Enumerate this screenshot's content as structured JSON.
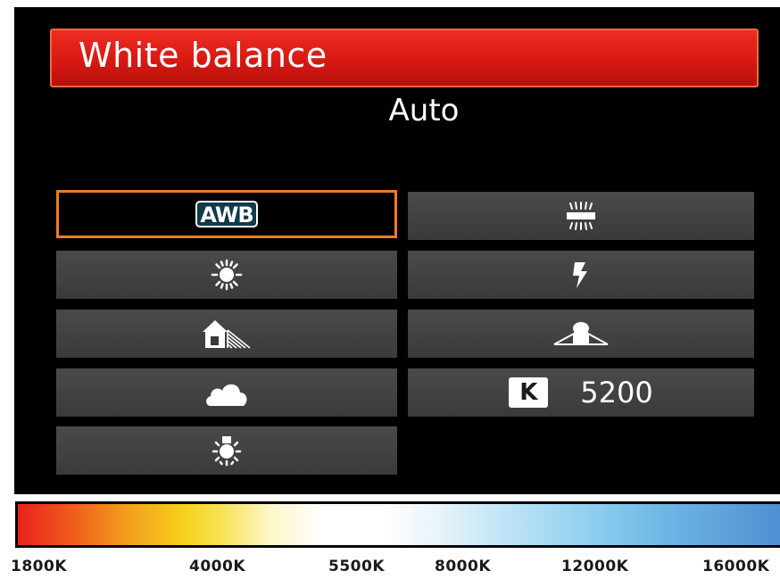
{
  "menu": {
    "title": "White balance",
    "selected_value": "Auto"
  },
  "options": {
    "awb_label": "AWB",
    "kelvin_label": "K",
    "kelvin_value": "5200",
    "icons": [
      "daylight-icon",
      "shade-icon",
      "cloudy-icon",
      "tungsten-icon",
      "fluorescent-icon",
      "flash-icon",
      "custom-wb-icon"
    ]
  },
  "scale": {
    "ticks": [
      "1800K",
      "4000K",
      "5500K",
      "8000K",
      "12000K",
      "16000K"
    ]
  },
  "colors": {
    "title_bar": "#d81912",
    "selection_border": "#f07a2a",
    "item_background": "#404040"
  }
}
